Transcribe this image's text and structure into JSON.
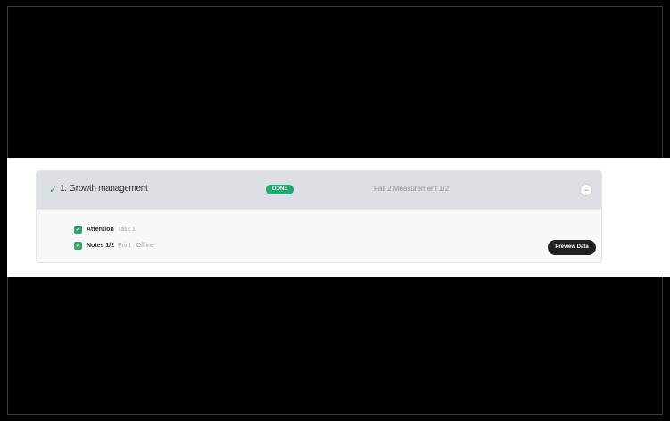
{
  "section": {
    "title": "1. Growth management",
    "status_badge": "DONE",
    "meta": "Fall 2 Measurement 1/2",
    "collapse_glyph": "−",
    "check_glyph": "✓"
  },
  "tasks": [
    {
      "name": "Attention",
      "detail": "Task 1"
    },
    {
      "name": "Notes 1/2",
      "detail": "Print · Offline"
    }
  ],
  "actions": {
    "preview_label": "Preview Data"
  },
  "colors": {
    "badge_green": "#1fa872",
    "check_green": "#3aa56b",
    "dark_button": "#1f2124"
  }
}
